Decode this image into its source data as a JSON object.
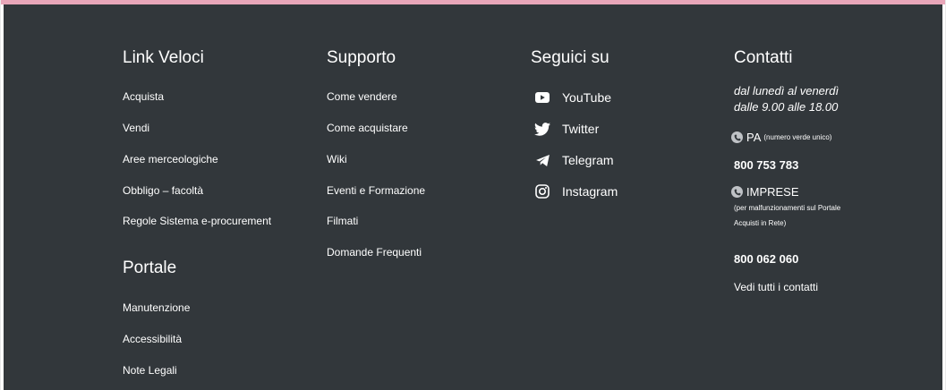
{
  "colors": {
    "accent_bar": "#e8a6b9",
    "footer_bg": "#32373b",
    "text": "#ffffff",
    "icon_muted": "#bfc2c6"
  },
  "link_veloci": {
    "heading": "Link Veloci",
    "items": [
      "Acquista",
      "Vendi",
      "Aree merceologiche",
      "Obbligo – facoltà",
      "Regole Sistema e-procurement"
    ]
  },
  "portale": {
    "heading": "Portale",
    "items": [
      "Manutenzione",
      "Accessibilità",
      "Note Legali"
    ]
  },
  "supporto": {
    "heading": "Supporto",
    "items": [
      "Come vendere",
      "Come acquistare",
      "Wiki",
      "Eventi e Formazione",
      "Filmati",
      "Domande Frequenti"
    ]
  },
  "seguici": {
    "heading": "Seguici su",
    "items": [
      {
        "label": "YouTube",
        "icon": "youtube-icon"
      },
      {
        "label": "Twitter",
        "icon": "twitter-icon"
      },
      {
        "label": "Telegram",
        "icon": "telegram-icon"
      },
      {
        "label": "Instagram",
        "icon": "instagram-icon"
      }
    ]
  },
  "contatti": {
    "heading": "Contatti",
    "hours_line1": "dal lunedì al venerdì",
    "hours_line2": "dalle 9.00 alle 18.00",
    "pa_title": "PA",
    "pa_note": "(numero verde unico)",
    "pa_phone": "800 753 783",
    "imprese_title": "IMPRESE",
    "imprese_note_line1": "(per malfunzionamenti sul Portale",
    "imprese_note_line2": "Acquisti in Rete)",
    "imprese_phone": "800 062 060",
    "all_contacts": "Vedi tutti i contatti"
  }
}
